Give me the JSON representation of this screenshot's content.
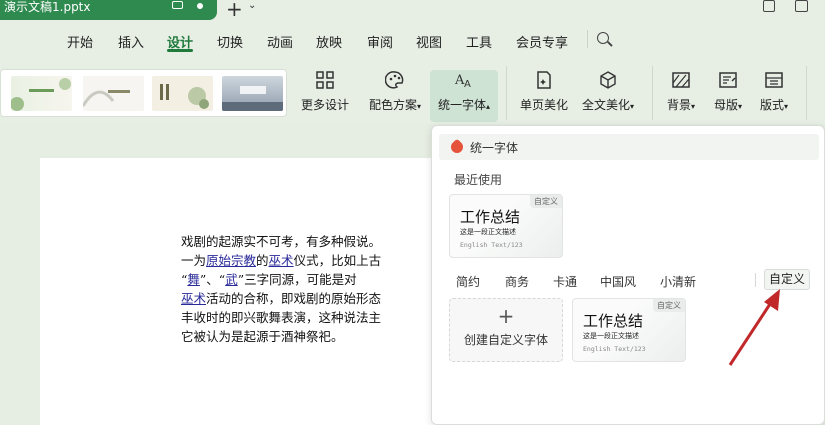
{
  "titlebar": {
    "doc_name": "演示文稿1.pptx"
  },
  "menu": {
    "items": [
      "开始",
      "插入",
      "设计",
      "切换",
      "动画",
      "放映",
      "审阅",
      "视图",
      "工具",
      "会员专享"
    ],
    "active": "设计"
  },
  "ribbon": {
    "more_design": "更多设计",
    "color_scheme": "配色方案",
    "unify_font": "统一字体",
    "single_beautify": "单页美化",
    "full_beautify": "全文美化",
    "background": "背景",
    "master": "母版",
    "layout": "版式",
    "thumb_titles": [
      "",
      "",
      "",
      ""
    ]
  },
  "slide": {
    "lines": [
      "戏剧的起源实不可考，有多种假说。",
      "一为原始宗教的巫术仪式，比如上古",
      "“舞”、“武”三字同源，可能是对",
      "巫术活动的合称，即戏剧的原始形态",
      "丰收时的即兴歌舞表演，这种说法主",
      "它被认为是起源于酒神祭祀。"
    ],
    "links": [
      "原始宗教",
      "巫术",
      "舞",
      "武"
    ]
  },
  "panel": {
    "title": "统一字体",
    "recent_label": "最近使用",
    "card_badge": "自定义",
    "card_title": "工作总结",
    "card_sample": "这是一段正文描述",
    "card_en": "English Text/123",
    "categories": [
      "简约",
      "商务",
      "卡通",
      "中国风",
      "小清新"
    ],
    "custom_tab": "自定义",
    "create_label": "创建自定义字体",
    "create_plus": "+"
  },
  "colors": {
    "accent": "#1f7a3c",
    "tab_green": "#2f8a4f",
    "arrow": "#c0282a"
  }
}
